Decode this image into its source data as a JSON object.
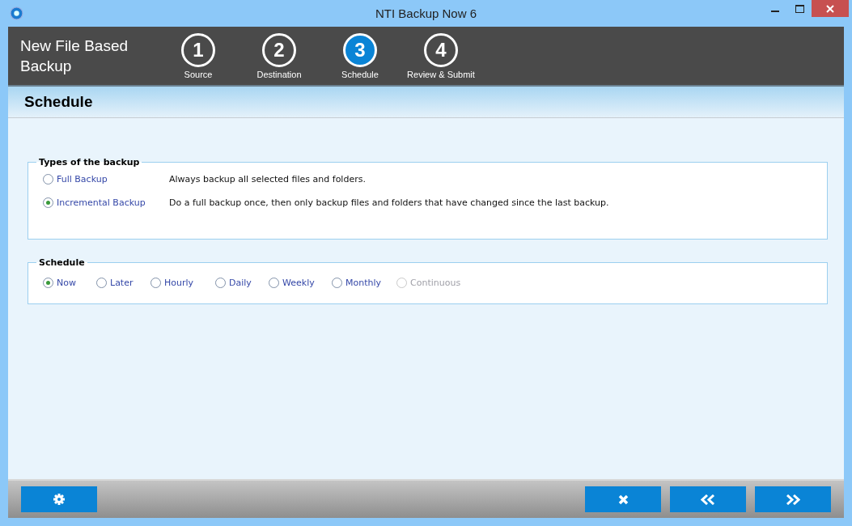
{
  "window": {
    "title": "NTI Backup Now 6"
  },
  "header": {
    "title": "New File Based Backup"
  },
  "steps": [
    {
      "number": "1",
      "label": "Source",
      "selected": false
    },
    {
      "number": "2",
      "label": "Destination",
      "selected": false
    },
    {
      "number": "3",
      "label": "Schedule",
      "selected": true
    },
    {
      "number": "4",
      "label": "Review & Submit",
      "selected": false
    }
  ],
  "section_title": "Schedule",
  "backup_types": {
    "legend": "Types of the backup",
    "options": [
      {
        "label": "Full Backup",
        "description": "Always backup all selected files and folders.",
        "selected": false
      },
      {
        "label": "Incremental Backup",
        "description": "Do a full backup once, then only backup files and folders that have changed since the last backup.",
        "selected": true
      }
    ]
  },
  "schedule": {
    "legend": "Schedule",
    "options": [
      {
        "label": "Now",
        "selected": true,
        "disabled": false
      },
      {
        "label": "Later",
        "selected": false,
        "disabled": false
      },
      {
        "label": "Hourly",
        "selected": false,
        "disabled": false
      },
      {
        "label": "Daily",
        "selected": false,
        "disabled": false
      },
      {
        "label": "Weekly",
        "selected": false,
        "disabled": false
      },
      {
        "label": "Monthly",
        "selected": false,
        "disabled": false
      },
      {
        "label": "Continuous",
        "selected": false,
        "disabled": true
      }
    ]
  }
}
